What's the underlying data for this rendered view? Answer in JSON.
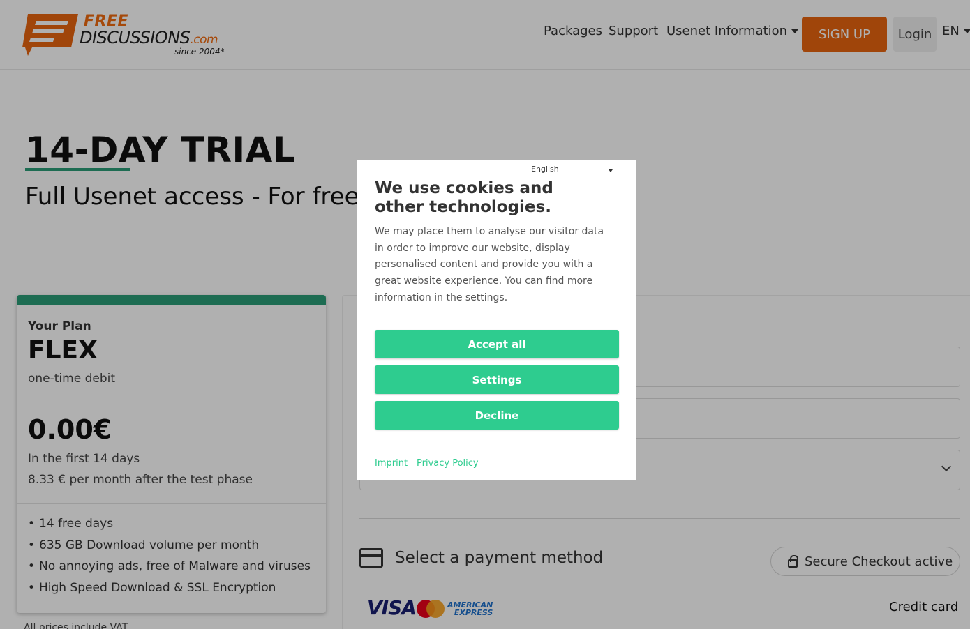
{
  "header": {
    "logo": {
      "free": "FREE",
      "discussions": "DISCUSSIONS",
      "com": ".com",
      "since": "since 2004*"
    },
    "nav": {
      "packages": "Packages",
      "support": "Support",
      "usenet_info": "Usenet Information"
    },
    "signup": "SIGN UP",
    "login": "Login",
    "lang": "EN"
  },
  "hero": {
    "title": "14-DAY TRIAL",
    "subtitle": "Full Usenet access - For free"
  },
  "plan": {
    "label": "Your Plan",
    "name": "FLEX",
    "billing": "one-time debit",
    "price": "0.00€",
    "price_note": "In the first 14 days",
    "price_after": "8.33 € per month after the test phase",
    "features": [
      "14 free days",
      "635 GB Download volume per month",
      "No annoying ads, free of Malware and viruses",
      "High Speed Download & SSL Encryption"
    ],
    "vat": "All prices include VAT"
  },
  "payment": {
    "title": "Select a payment method",
    "secure": "Secure Checkout active",
    "visa": "VISA",
    "amex_line1": "AMERICAN",
    "amex_line2": "EXPRESS",
    "method": "Credit card"
  },
  "cookie": {
    "language": "English",
    "title": "We use cookies and other technologies.",
    "text": "We may place them to analyse our visitor data in order to improve our website, display personalised content and provide you with a great website experience. You can find more information in the settings.",
    "accept": "Accept all",
    "settings": "Settings",
    "decline": "Decline",
    "imprint": "Imprint",
    "privacy": "Privacy Policy"
  },
  "colors": {
    "brand_orange": "#e8650f",
    "accent_green": "#2a9d78",
    "cookie_button": "#2ecc8f"
  },
  "icons": [
    "chat-logo-icon",
    "chevron-down-icon",
    "credit-card-icon",
    "lock-icon",
    "mastercard-icon"
  ]
}
